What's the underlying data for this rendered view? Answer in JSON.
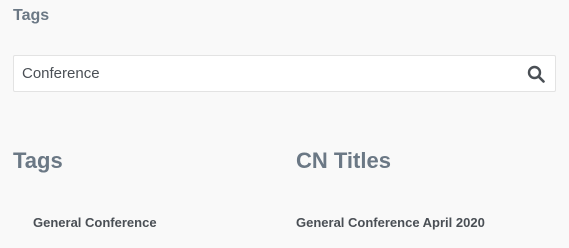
{
  "page": {
    "title": "Tags"
  },
  "search": {
    "value": "Conference",
    "icon": "search-icon"
  },
  "columns": {
    "tags": {
      "heading": "Tags",
      "items": [
        {
          "label": "General Conference"
        }
      ]
    },
    "titles": {
      "heading": "CN Titles",
      "items": [
        {
          "label": "General Conference April 2020"
        }
      ]
    }
  },
  "colors": {
    "heading": "#6b7885",
    "text": "#4a4f55",
    "background": "#f9f9f9"
  }
}
